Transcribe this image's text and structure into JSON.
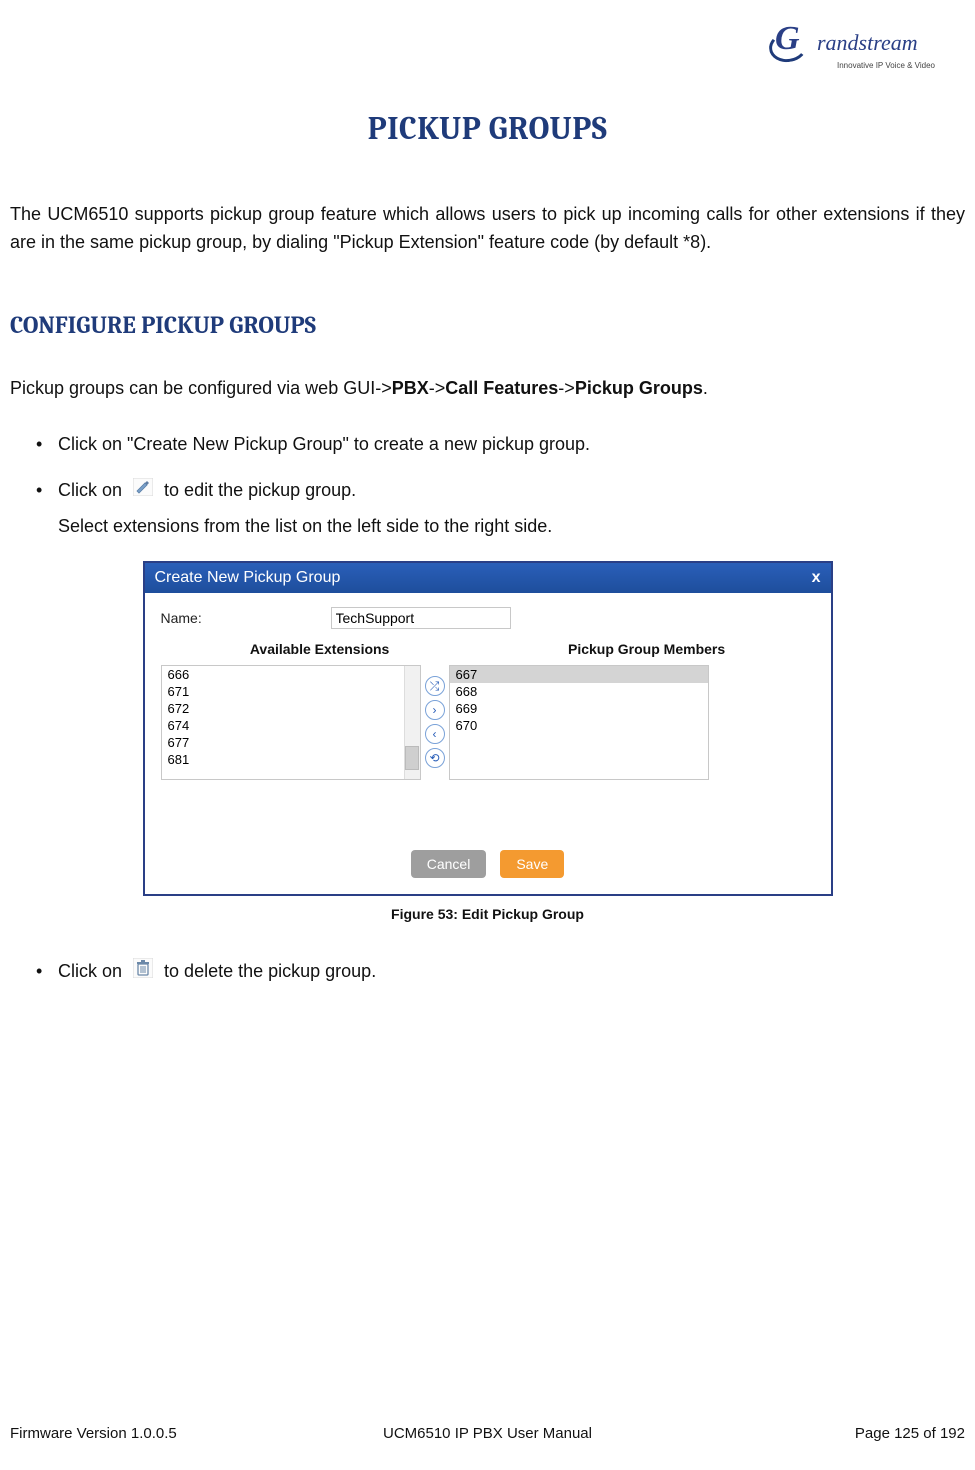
{
  "logo": {
    "brand": "randstream",
    "g": "G",
    "tagline": "Innovative IP Voice & Video"
  },
  "title": "PICKUP GROUPS",
  "intro": "The UCM6510 supports pickup group feature which allows users to pick up incoming calls for other extensions if they are in the same pickup group, by dialing \"Pickup Extension\" feature code (by default *8).",
  "section": "CONFIGURE PICKUP GROUPS",
  "config_para": {
    "prefix": "Pickup groups can be configured via web GUI->",
    "b1": "PBX",
    "sep1": "->",
    "b2": "Call Features",
    "sep2": "->",
    "b3": "Pickup Groups",
    "suffix": "."
  },
  "bullets": {
    "b0": "Click on \"Create New Pickup Group\" to create a new pickup group.",
    "b1_pre": "Click on ",
    "b1_post": " to edit the pickup group.",
    "b1_after": "Select extensions from the list on the left side to the right side.",
    "b2_pre": "Click on ",
    "b2_post": " to delete the pickup group."
  },
  "icons": {
    "edit_alt": "edit-icon",
    "delete_alt": "trash-icon"
  },
  "shot": {
    "title": "Create New Pickup Group",
    "name_label": "Name:",
    "name_value": "TechSupport",
    "col_left": "Available Extensions",
    "col_right": "Pickup Group Members",
    "left_items": [
      "666",
      "671",
      "672",
      "674",
      "677",
      "681"
    ],
    "right_items": [
      "667",
      "668",
      "669",
      "670"
    ],
    "move_btns": [
      "⤮",
      "›",
      "‹",
      "⟲"
    ],
    "cancel": "Cancel",
    "save": "Save"
  },
  "caption": "Figure 53: Edit Pickup Group",
  "footer": {
    "left": "Firmware Version 1.0.0.5",
    "center": "UCM6510 IP PBX User Manual",
    "right": "Page 125 of 192"
  }
}
